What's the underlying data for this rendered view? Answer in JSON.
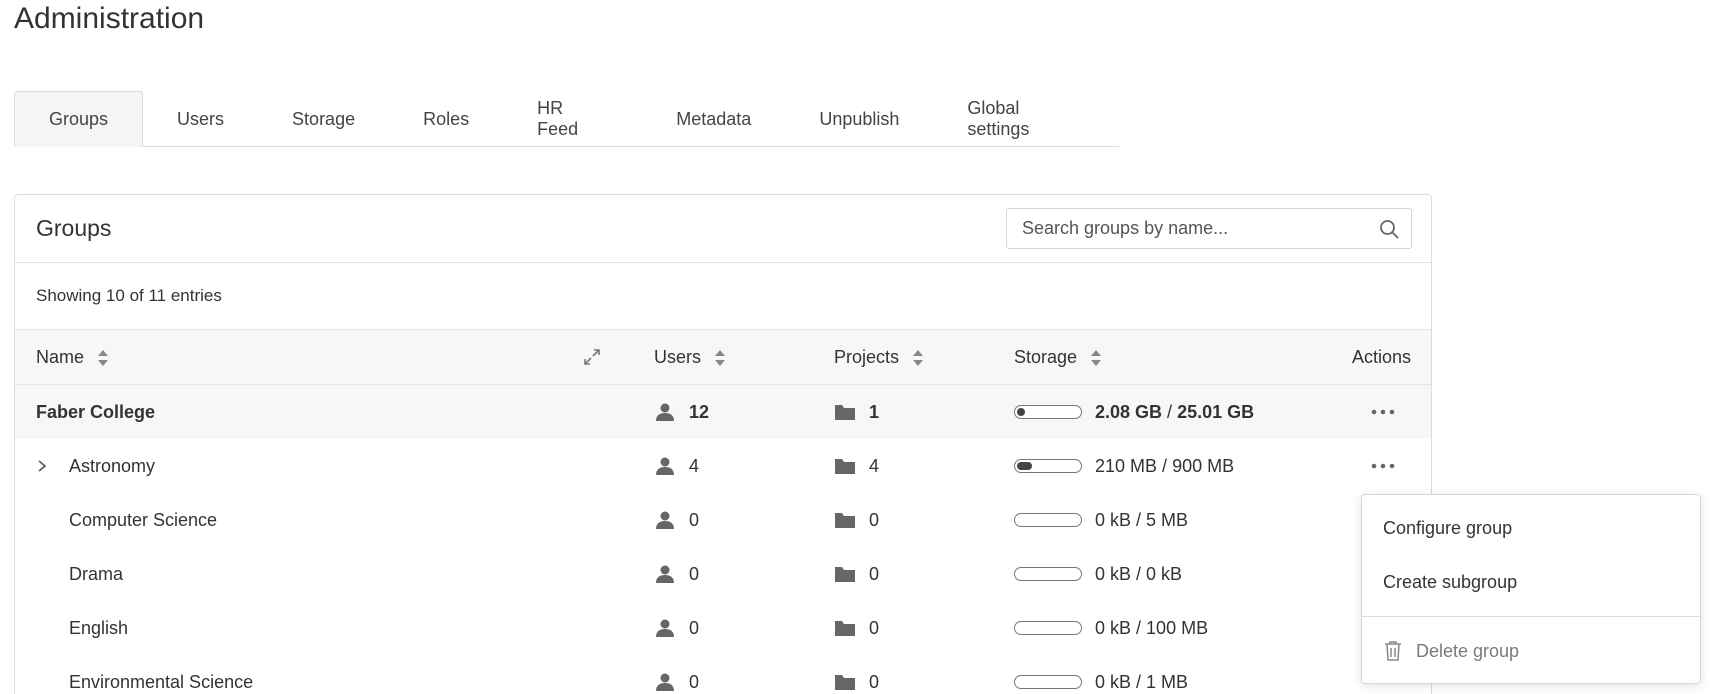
{
  "page": {
    "title": "Administration"
  },
  "tabs": [
    {
      "label": "Groups",
      "active": true
    },
    {
      "label": "Users",
      "active": false
    },
    {
      "label": "Storage",
      "active": false
    },
    {
      "label": "Roles",
      "active": false
    },
    {
      "label": "HR Feed",
      "active": false
    },
    {
      "label": "Metadata",
      "active": false
    },
    {
      "label": "Unpublish",
      "active": false
    },
    {
      "label": "Global settings",
      "active": false
    }
  ],
  "panel": {
    "title": "Groups",
    "search": {
      "placeholder": "Search groups by name...",
      "value": ""
    },
    "entries_text": "Showing 10 of 11 entries"
  },
  "table": {
    "columns": {
      "name": "Name",
      "users": "Users",
      "projects": "Projects",
      "storage": "Storage",
      "actions": "Actions"
    },
    "rows": [
      {
        "name": "Faber College",
        "users": "12",
        "projects": "1",
        "used": "2.08 GB",
        "quota": "25.01 GB",
        "usage_fraction": 0.083,
        "root": true,
        "expandable": false,
        "has_actions": true
      },
      {
        "name": "Astronomy",
        "users": "4",
        "projects": "4",
        "used": "210 MB",
        "quota": "900 MB",
        "usage_fraction": 0.233,
        "root": false,
        "expandable": true,
        "has_actions": true
      },
      {
        "name": "Computer Science",
        "users": "0",
        "projects": "0",
        "used": "0 kB",
        "quota": "5 MB",
        "usage_fraction": 0,
        "root": false,
        "expandable": false,
        "has_actions": false
      },
      {
        "name": "Drama",
        "users": "0",
        "projects": "0",
        "used": "0 kB",
        "quota": "0 kB",
        "usage_fraction": 0,
        "root": false,
        "expandable": false,
        "has_actions": false
      },
      {
        "name": "English",
        "users": "0",
        "projects": "0",
        "used": "0 kB",
        "quota": "100 MB",
        "usage_fraction": 0,
        "root": false,
        "expandable": false,
        "has_actions": false
      },
      {
        "name": "Environmental Science",
        "users": "0",
        "projects": "0",
        "used": "0 kB",
        "quota": "1 MB",
        "usage_fraction": 0,
        "root": false,
        "expandable": false,
        "has_actions": false
      }
    ],
    "separator": "/"
  },
  "context_menu": {
    "items": [
      {
        "label": "Configure group",
        "disabled": false
      },
      {
        "label": "Create subgroup",
        "disabled": false
      },
      {
        "label": "Delete group",
        "disabled": true,
        "icon": "trash-icon"
      }
    ]
  },
  "colors": {
    "icon_gray": "#666666",
    "header_bg": "#f7f7f7",
    "border": "#dcdcdc"
  }
}
